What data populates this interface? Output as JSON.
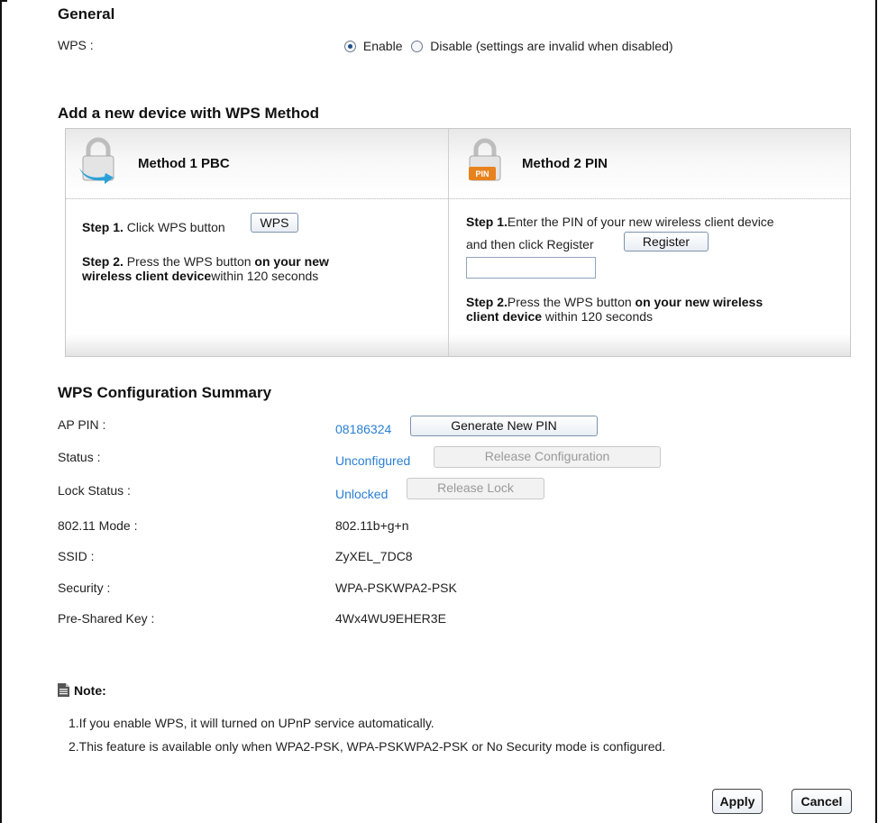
{
  "general": {
    "title": "General",
    "wps_label": "WPS :",
    "enable_label": "Enable",
    "disable_label": "Disable (settings are invalid when disabled)",
    "enabled": true
  },
  "methods": {
    "title": "Add a new device with WPS Method",
    "pbc": {
      "title": "Method 1 PBC",
      "step1_bold": "Step 1.",
      "step1_text": " Click WPS button",
      "wps_button": "WPS",
      "step2_bold": "Step 2.",
      "step2_text": " Press the WPS button ",
      "step2_bold2": "on your new wireless client device",
      "step2_tail": "within 120 seconds"
    },
    "pin": {
      "title": "Method 2 PIN",
      "icon_text": "PIN",
      "step1_bold": "Step 1.",
      "step1_text": "Enter the PIN of your new wireless client device",
      "step1_text2": "and then click Register",
      "register_button": "Register",
      "pin_value": "",
      "step2_bold": "Step 2.",
      "step2_text": "Press the WPS button ",
      "step2_bold2": "on your new wireless",
      "step2_bold3": "client device",
      "step2_tail": " within 120 seconds"
    }
  },
  "summary": {
    "title": "WPS Configuration Summary",
    "ap_pin_label": "AP PIN :",
    "ap_pin_value": "08186324",
    "generate_button": "Generate New PIN",
    "status_label": "Status :",
    "status_value": "Unconfigured",
    "release_config_button": "Release Configuration",
    "lock_label": "Lock Status :",
    "lock_value": "Unlocked",
    "release_lock_button": "Release Lock",
    "mode_label": "802.11 Mode :",
    "mode_value": "802.11b+g+n",
    "ssid_label": "SSID :",
    "ssid_value": "ZyXEL_7DC8",
    "security_label": "Security :",
    "security_value": "WPA-PSKWPA2-PSK",
    "psk_label": "Pre-Shared Key :",
    "psk_value": "4Wx4WU9EHER3E"
  },
  "note": {
    "title": "Note:",
    "line1": "1.If you enable WPS, it will turned on UPnP service automatically.",
    "line2": "2.This feature is available only when WPA2-PSK, WPA-PSKWPA2-PSK or No Security mode is configured."
  },
  "actions": {
    "apply": "Apply",
    "cancel": "Cancel"
  },
  "colors": {
    "link": "#2a7fd4",
    "lock_blue": "#2aa0d8",
    "pin_orange": "#e8821e"
  }
}
